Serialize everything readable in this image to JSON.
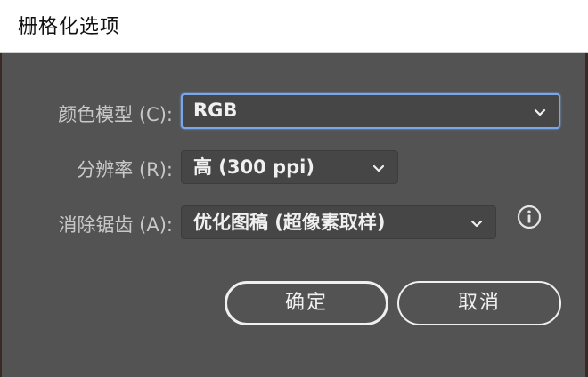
{
  "dialog": {
    "title": "栅格化选项"
  },
  "fields": {
    "color_model": {
      "label": "颜色模型 (C):",
      "value": "RGB"
    },
    "resolution": {
      "label": "分辨率 (R):",
      "value": "高 (300 ppi)"
    },
    "anti_aliasing": {
      "label": "消除锯齿 (A):",
      "value": "优化图稿 (超像素取样)"
    }
  },
  "buttons": {
    "ok": "确定",
    "cancel": "取消"
  },
  "icons": {
    "info": "info-icon",
    "dropdown": "chevron-down-icon"
  },
  "colors": {
    "dialog_bg": "#535353",
    "focus_ring": "#7aa6ea",
    "label_text": "#c8c8c8"
  }
}
